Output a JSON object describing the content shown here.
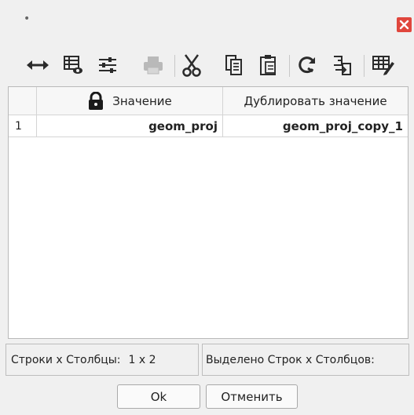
{
  "window": {
    "title": "•",
    "close_icon": "close-icon",
    "accent_close": "#e0463c"
  },
  "toolbar": {
    "icons": [
      "resize-columns-icon",
      "table-view-icon",
      "settings-sliders-icon",
      "print-icon",
      "cut-icon",
      "copy-icon",
      "paste-icon",
      "refresh-icon",
      "import-icon",
      "edit-table-icon"
    ]
  },
  "grid": {
    "columns": [
      {
        "label": "Значение",
        "locked": true
      },
      {
        "label": "Дублировать значение",
        "locked": false
      }
    ],
    "rows": [
      {
        "index": "1",
        "cells": [
          "geom_proj",
          "geom_proj_copy_1"
        ]
      }
    ]
  },
  "status": {
    "rows_cols_label": "Строки x Столбцы:",
    "rows_cols_value": "1 x 2",
    "selected_label": "Выделено Строк x Столбцов:"
  },
  "buttons": {
    "ok": "Ok",
    "cancel": "Отменить"
  }
}
